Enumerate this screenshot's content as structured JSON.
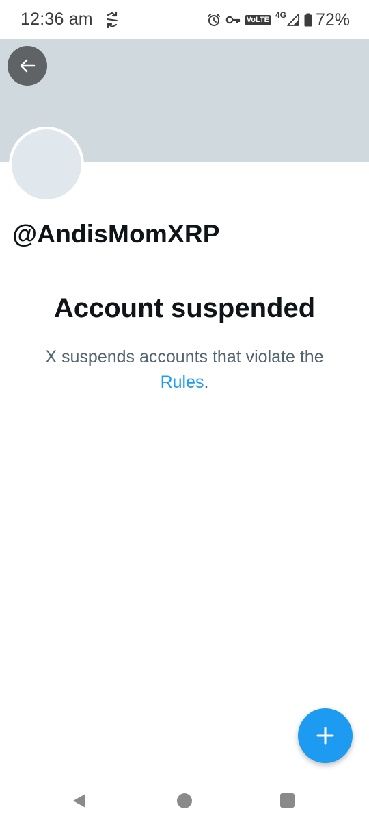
{
  "status_bar": {
    "time": "12:36 am",
    "network": "4G",
    "volte": "VoLTE",
    "battery": "72%",
    "icons": [
      "sync-icon",
      "alarm-icon",
      "vpn-key-icon",
      "volte-icon",
      "signal-icon",
      "battery-icon"
    ]
  },
  "profile": {
    "handle": "@AndisMomXRP"
  },
  "suspension": {
    "title": "Account suspended",
    "text_before": "X suspends accounts that violate the ",
    "link_text": "Rules",
    "text_after": "."
  },
  "colors": {
    "banner": "#cfd9de",
    "avatar": "#e1e8ed",
    "accent": "#1d9bf0",
    "text_primary": "#0f1419",
    "text_secondary": "#536471"
  },
  "icons": {
    "back": "arrow-left-icon",
    "compose": "plus-icon"
  }
}
